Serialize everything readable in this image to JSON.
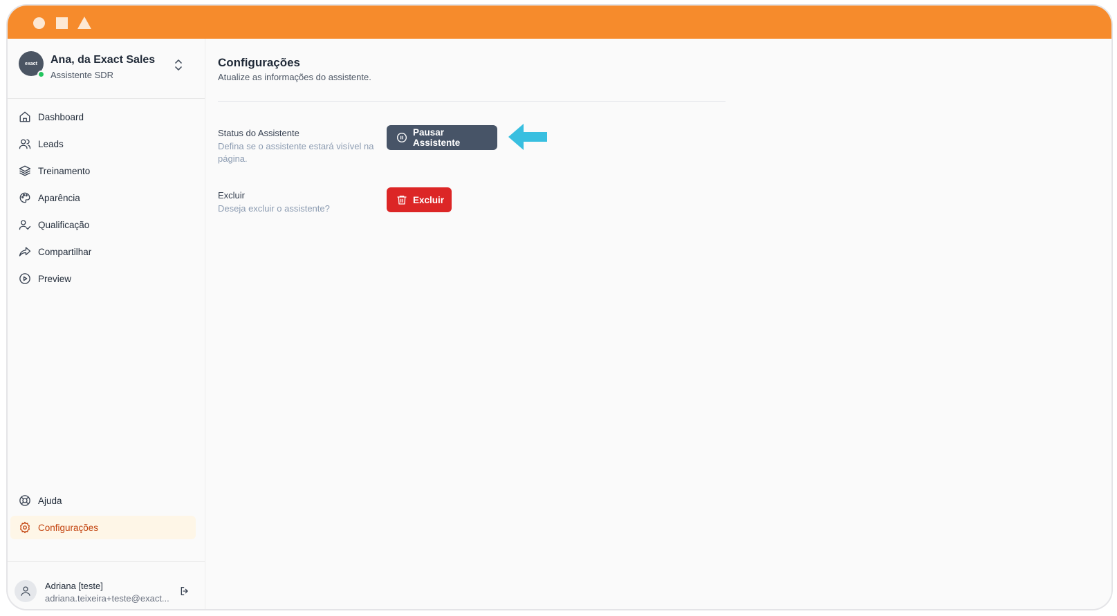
{
  "titlebar": {
    "color": "#f68b2c"
  },
  "brand": {
    "logo_text": "exact",
    "name": "Ana, da Exact Sales",
    "subtitle": "Assistente SDR"
  },
  "nav": {
    "items": [
      {
        "label": "Dashboard",
        "icon": "home-icon"
      },
      {
        "label": "Leads",
        "icon": "users-icon"
      },
      {
        "label": "Treinamento",
        "icon": "layers-icon"
      },
      {
        "label": "Aparência",
        "icon": "palette-icon"
      },
      {
        "label": "Qualificação",
        "icon": "user-check-icon"
      },
      {
        "label": "Compartilhar",
        "icon": "share-icon"
      },
      {
        "label": "Preview",
        "icon": "play-circle-icon"
      }
    ],
    "bottom_items": [
      {
        "label": "Ajuda",
        "icon": "lifebuoy-icon"
      },
      {
        "label": "Configurações",
        "icon": "gear-icon",
        "active": true
      }
    ]
  },
  "user": {
    "name": "Adriana [teste]",
    "email": "adriana.teixeira+teste@exact..."
  },
  "main": {
    "title": "Configurações",
    "subtitle": "Atualize as informações do assistente.",
    "status": {
      "label": "Status do Assistente",
      "description": "Defina se o assistente estará visível na página.",
      "button_label": "Pausar Assistente"
    },
    "delete": {
      "label": "Excluir",
      "description": "Deseja excluir o assistente?",
      "button_label": "Excluir"
    }
  },
  "colors": {
    "accent": "#f68b2c",
    "pause_button": "#475467",
    "delete_button": "#dc2626",
    "active_nav_text": "#c2410c",
    "annotation_arrow": "#38bfe0"
  }
}
